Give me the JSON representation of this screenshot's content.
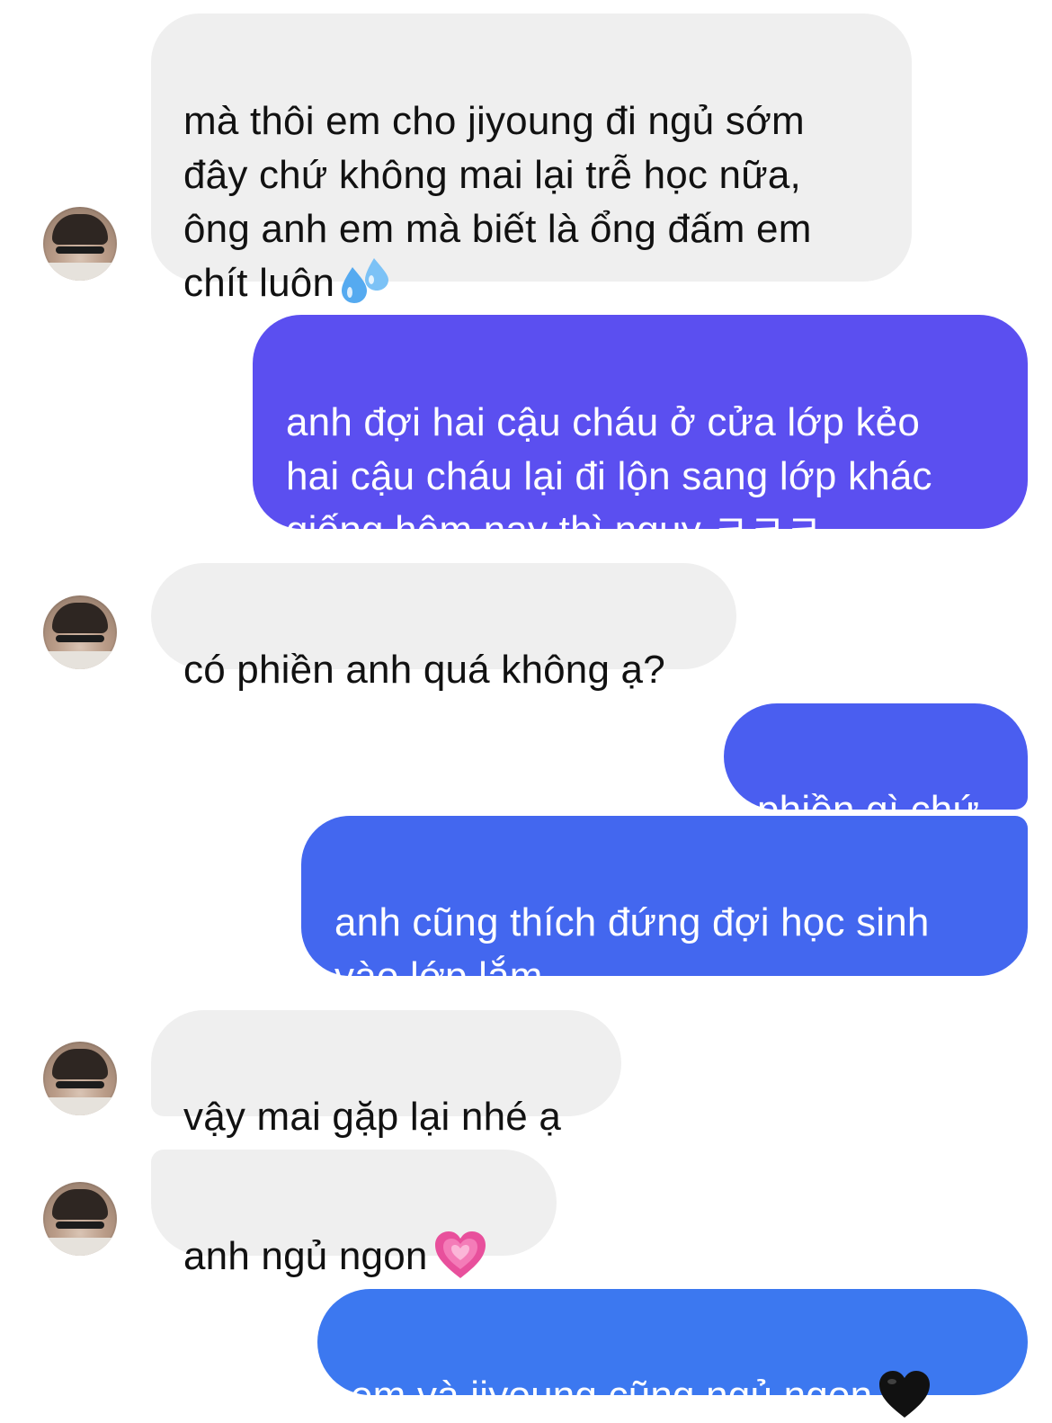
{
  "colors": {
    "incoming_bg": "#efefef",
    "outgoing_top": "#5b4ff0",
    "outgoing_mid": "#4262ee",
    "outgoing_bottom": "#3c78f0"
  },
  "messages": [
    {
      "direction": "incoming",
      "text": "mà thôi em cho jiyoung đi ngủ sớm\nđây chứ không mai lại trễ học nữa,\nông anh em mà biết là ổng đấm em\nchít luôn",
      "emoji": "sweat-droplets"
    },
    {
      "direction": "outgoing",
      "text": "anh đợi hai cậu cháu ở cửa lớp kẻo\nhai cậu cháu lại đi lộn sang lớp khác\ngiống hôm nay thì nguy ㅋㅋㅋ"
    },
    {
      "direction": "incoming",
      "text": "có phiền anh quá không ạ?"
    },
    {
      "direction": "outgoing",
      "text": "phiền gì chứ"
    },
    {
      "direction": "outgoing",
      "text": "anh cũng thích đứng đợi học sinh\nvào lớp lắm"
    },
    {
      "direction": "incoming",
      "text": "vậy mai gặp lại nhé ạ"
    },
    {
      "direction": "incoming",
      "text": "anh ngủ ngon",
      "emoji": "growing-heart"
    },
    {
      "direction": "outgoing",
      "text": "em và jiyoung cũng ngủ ngon",
      "emoji": "black-heart"
    }
  ]
}
